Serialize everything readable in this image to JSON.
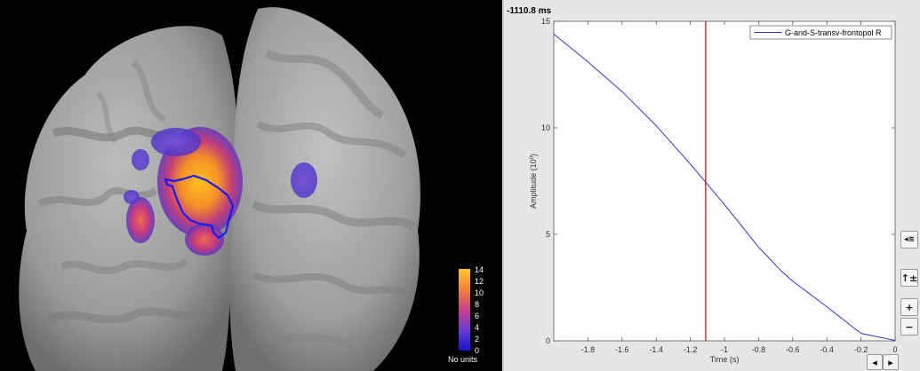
{
  "colorbar": {
    "ticks": [
      "14",
      "12",
      "10",
      "8",
      "6",
      "4",
      "2",
      "0"
    ],
    "unit_label": "No units"
  },
  "plot": {
    "time_readout": "-1110.8 ms",
    "legend": "G-and-S-transv-frontopol R",
    "xlabel": "Time (s)",
    "ylabel_base": "Amplitude (10",
    "ylabel_exp": "0",
    "ylabel_close": ")",
    "cursor_time": -1.11,
    "line_color": "#3333cc",
    "cursor_color": "#cc0000"
  },
  "chart_data": {
    "type": "line",
    "xlabel": "Time (s)",
    "ylabel": "Amplitude (10^0)",
    "xlim": [
      -2.0,
      0
    ],
    "ylim": [
      0,
      15
    ],
    "x_ticks": [
      "-1.8",
      "-1.6",
      "-1.4",
      "-1.2",
      "-1",
      "-0.8",
      "-0.6",
      "-0.4",
      "-0.2",
      "0"
    ],
    "x_tick_values": [
      -1.8,
      -1.6,
      -1.4,
      -1.2,
      -1.0,
      -0.8,
      -0.6,
      -0.4,
      -0.2,
      0
    ],
    "y_ticks": [
      "0",
      "5",
      "10",
      "15"
    ],
    "y_tick_values": [
      0,
      5,
      10,
      15
    ],
    "legend_position": "top-right",
    "series": [
      {
        "name": "G-and-S-transv-frontopol R",
        "x": [
          -2.0,
          -1.8,
          -1.6,
          -1.4,
          -1.2,
          -1.0,
          -0.8,
          -0.67,
          -0.6,
          -0.4,
          -0.2,
          0
        ],
        "y": [
          14.4,
          13.1,
          11.7,
          10.1,
          8.3,
          6.4,
          4.4,
          3.3,
          2.8,
          1.6,
          0.35,
          0.02
        ]
      }
    ]
  },
  "toolbar": {
    "btn_wave": "◂≋",
    "btn_scale": "↑±",
    "btn_zoom_in": "+",
    "btn_zoom_out": "−",
    "btn_left": "◂",
    "btn_right": "▸"
  }
}
